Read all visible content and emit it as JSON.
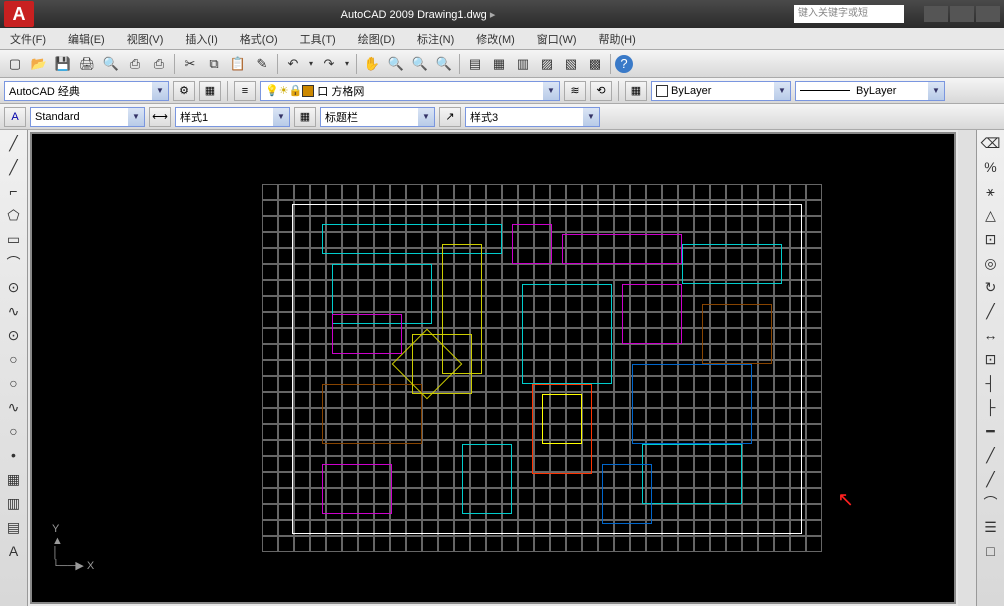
{
  "title": {
    "app": "AutoCAD 2009",
    "file": "Drawing1.dwg",
    "search_placeholder": "键入关键字或短"
  },
  "menus": [
    "文件(F)",
    "编辑(E)",
    "视图(V)",
    "插入(I)",
    "格式(O)",
    "工具(T)",
    "绘图(D)",
    "标注(N)",
    "修改(M)",
    "窗口(W)",
    "帮助(H)"
  ],
  "std_icons": [
    "new",
    "open",
    "save",
    "print",
    "preview",
    "print-sel",
    "scissors",
    "cut",
    "copy",
    "paste",
    "match",
    "undo",
    "redo",
    "pan",
    "zoom-rt",
    "zoom-win",
    "zoom-prev",
    "prop",
    "sheet",
    "design",
    "tool-pal",
    "calc",
    "help"
  ],
  "workspace": {
    "value": "AutoCAD 经典"
  },
  "layer": {
    "value": "口 方格网"
  },
  "bylayer_color": "ByLayer",
  "linetype": "ByLayer",
  "text_style": "Standard",
  "dim_style": "样式1",
  "table_style": "标题栏",
  "mleader_style": "样式3",
  "draw_tools": [
    "╱",
    "╱",
    "⌐",
    "⬠",
    "▭",
    "⌒",
    "⊙",
    "∿",
    "⊙",
    "○",
    "○",
    "∿",
    "○",
    "•",
    "▦",
    "▥",
    "▤",
    "A"
  ],
  "modify_tools": [
    "⌫",
    "%",
    "⚹",
    "△",
    "⊡",
    "◎",
    "↻",
    "╱",
    "↔",
    "⊡",
    "┤",
    "├",
    "━",
    "╱",
    "╱",
    "⌒",
    "☰",
    "□"
  ],
  "ucs_label": {
    "y": "Y",
    "x": "X"
  }
}
